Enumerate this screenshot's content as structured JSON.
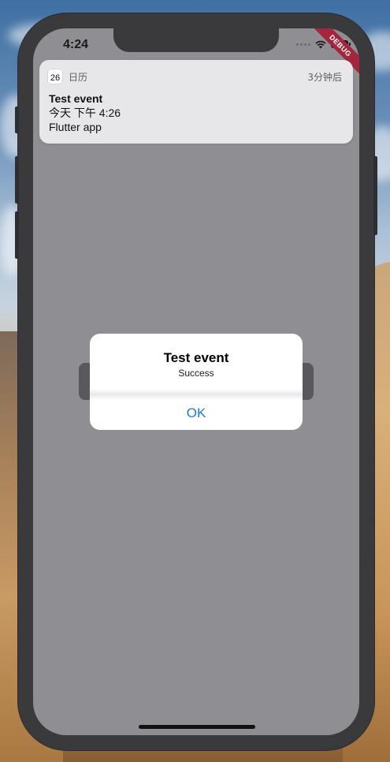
{
  "status_bar": {
    "time": "4:24",
    "debug_label": "DEBUG"
  },
  "notification": {
    "app_icon_day": "26",
    "app_name": "日历",
    "time_ago": "3分钟后",
    "title": "Test event",
    "subtitle": "今天 下午 4:26",
    "body": "Flutter app"
  },
  "dialog": {
    "title": "Test event",
    "message": "Success",
    "ok_label": "OK"
  },
  "colors": {
    "accent": "#1a7bdc",
    "debug_ribbon": "#a3263d",
    "screen_background": "#8f8e93"
  },
  "icons": [
    "wifi-icon",
    "battery-icon",
    "cellular-signal-icon",
    "calendar-icon"
  ]
}
